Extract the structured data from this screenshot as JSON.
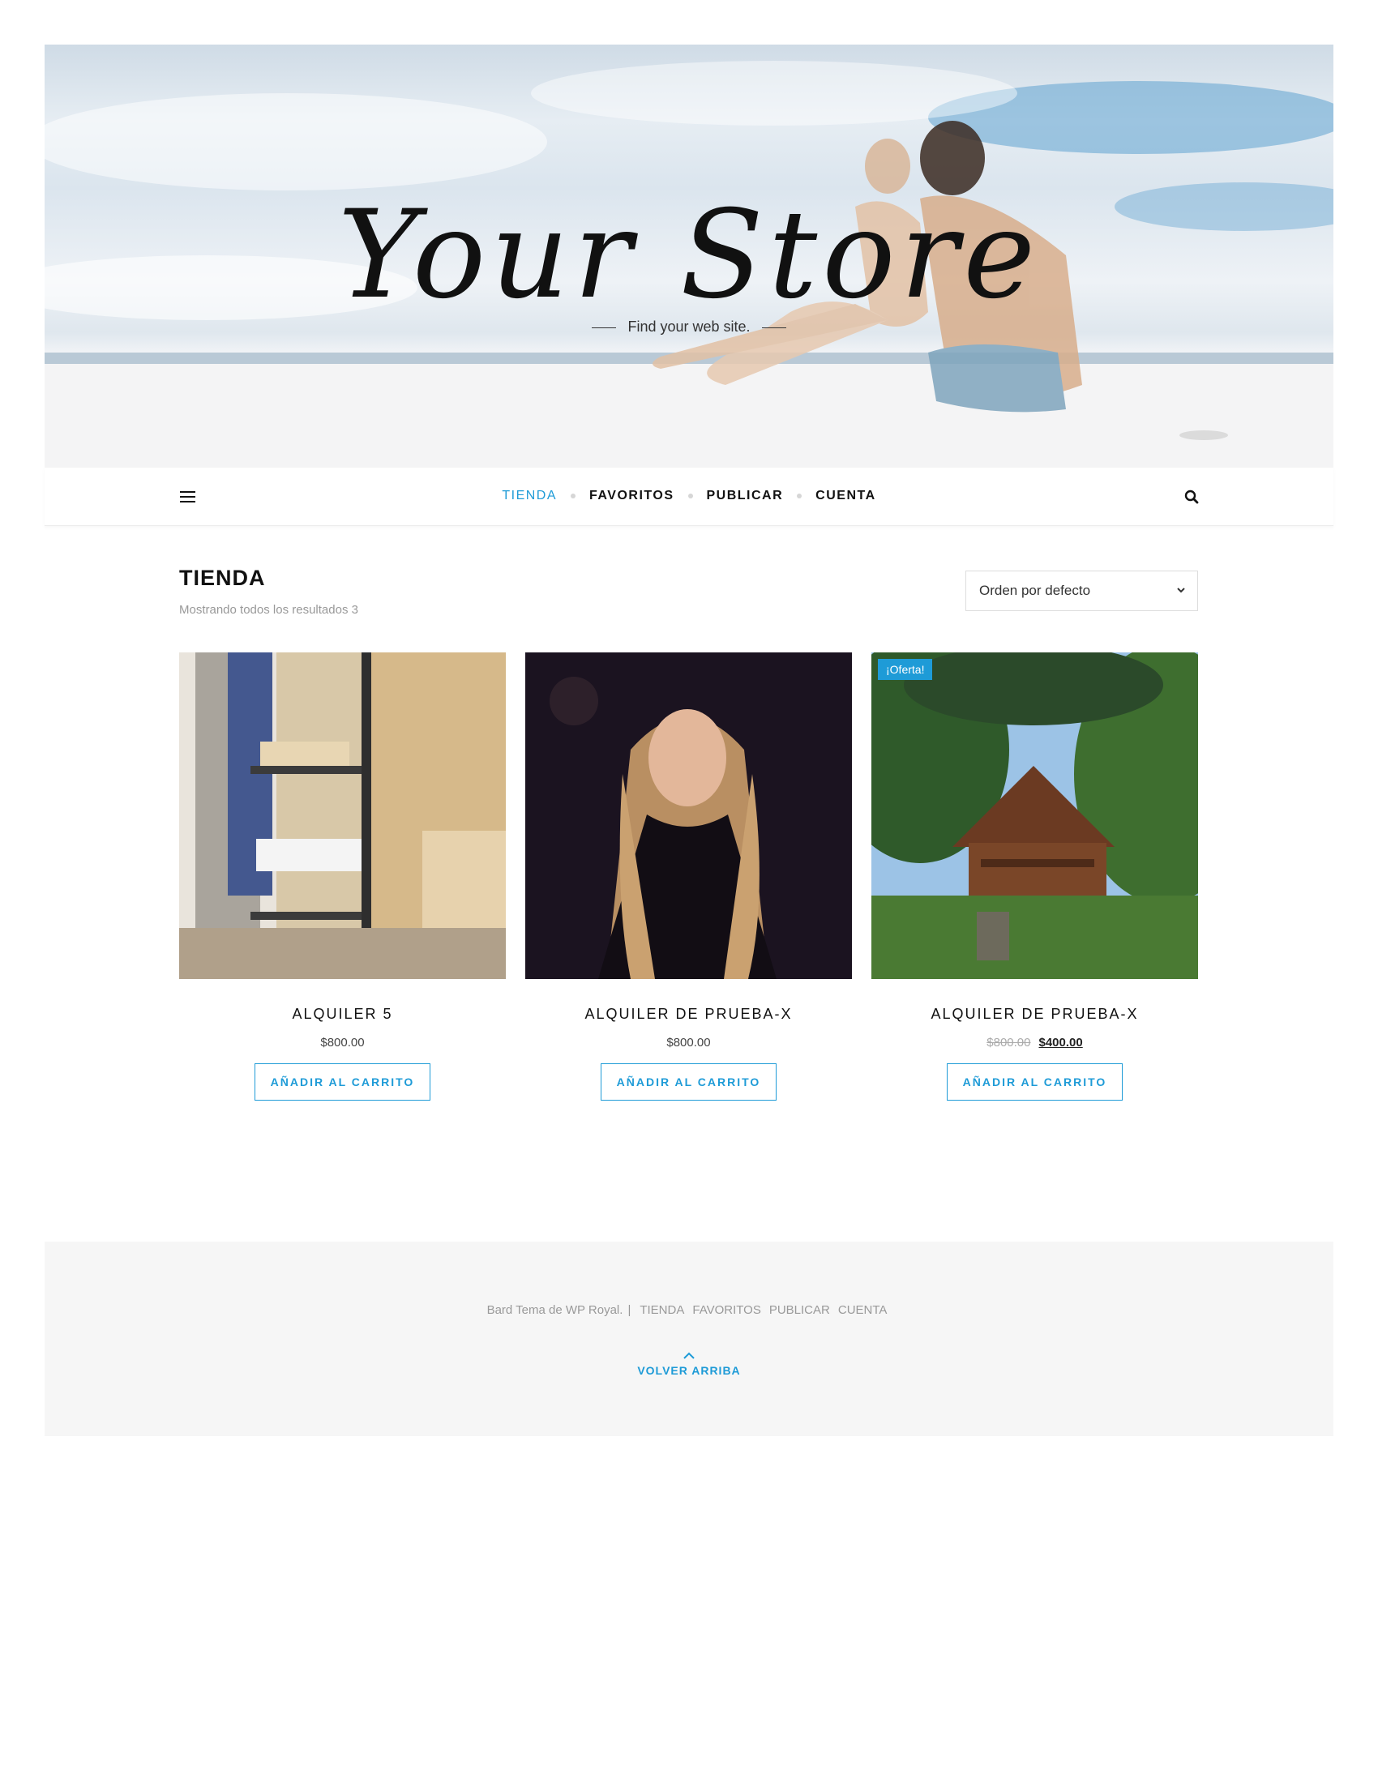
{
  "header": {
    "logo": "Your Store",
    "tagline": "Find your web site."
  },
  "nav": {
    "items": [
      {
        "label": "TIENDA",
        "active": true
      },
      {
        "label": "FAVORITOS",
        "active": false
      },
      {
        "label": "PUBLICAR",
        "active": false
      },
      {
        "label": "CUENTA",
        "active": false
      }
    ],
    "menu_icon": "hamburger-icon",
    "search_icon": "search-icon"
  },
  "shop": {
    "title": "TIENDA",
    "result_count": "Mostrando todos los resultados 3",
    "orderby": "Orden por defecto"
  },
  "products": [
    {
      "name": "ALQUILER 5",
      "price": "$800.00",
      "button": "AÑADIR AL CARRITO",
      "image": "bunk-bed-photo"
    },
    {
      "name": "ALQUILER DE PRUEBA-X",
      "price": "$800.00",
      "button": "AÑADIR AL CARRITO",
      "image": "portrait-photo"
    },
    {
      "name": "ALQUILER DE PRUEBA-X",
      "badge": "¡Oferta!",
      "old_price": "$800.00",
      "price": "$400.00",
      "button": "AÑADIR AL CARRITO",
      "image": "cabin-photo"
    }
  ],
  "footer": {
    "credit": "Bard Tema de WP Royal.",
    "separator": "|",
    "links": [
      "TIENDA",
      "FAVORITOS",
      "PUBLICAR",
      "CUENTA"
    ],
    "back_to_top": "VOLVER ARRIBA"
  },
  "colors": {
    "accent": "#1e9bd7",
    "text": "#111111",
    "muted": "#999999",
    "footer_bg": "#f6f6f6"
  }
}
